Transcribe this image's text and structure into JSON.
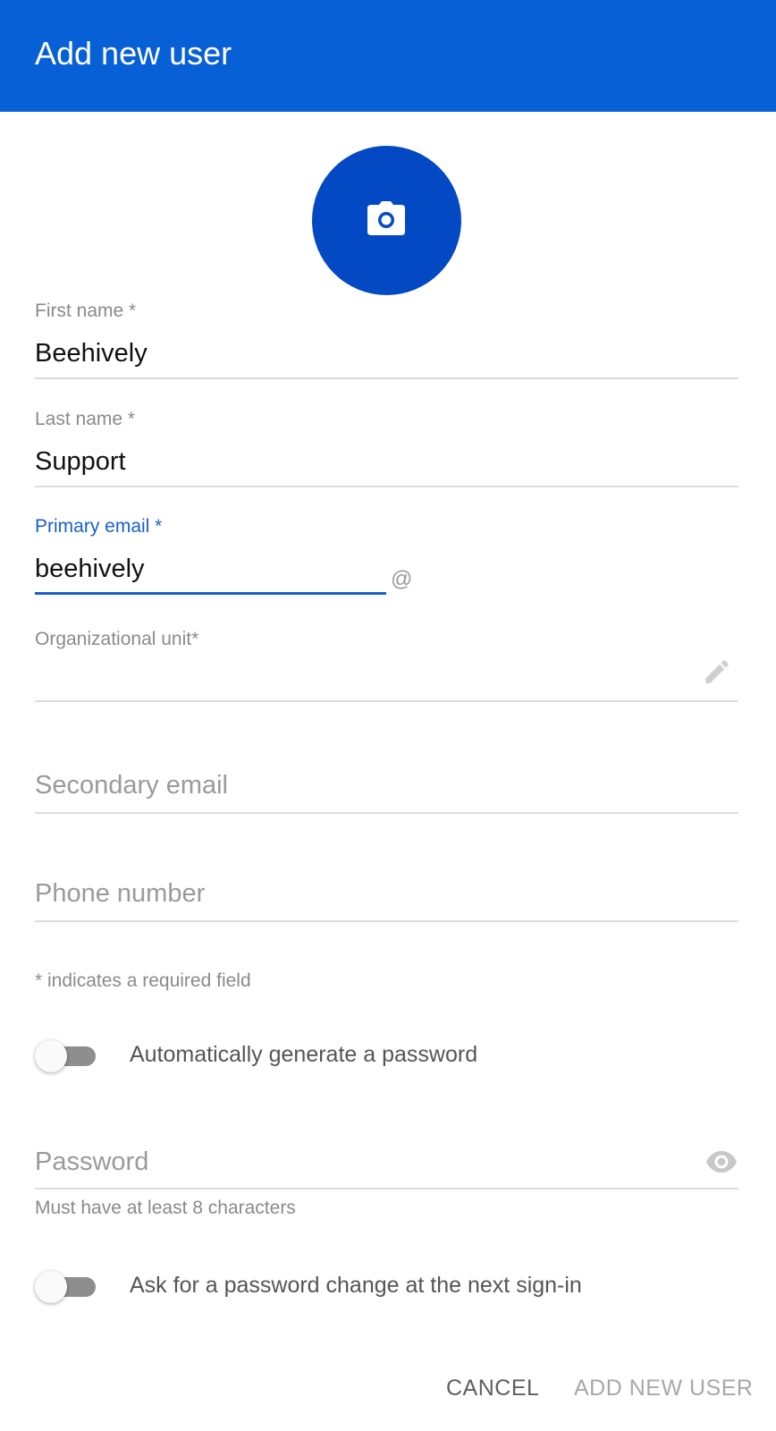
{
  "header": {
    "title": "Add new user"
  },
  "photo": {
    "icon": "camera-icon",
    "bg_color": "#0449c4"
  },
  "form": {
    "first_name": {
      "label": "First name *",
      "value": "Beehively"
    },
    "last_name": {
      "label": "Last name *",
      "value": "Support"
    },
    "primary_email": {
      "label": "Primary email *",
      "value": "beehively",
      "at_symbol": "@"
    },
    "org_unit": {
      "label": "Organizational unit*",
      "edit_icon": "pencil-icon"
    },
    "secondary_email": {
      "placeholder": "Secondary email"
    },
    "phone_number": {
      "placeholder": "Phone number"
    },
    "required_note": "* indicates a required field",
    "auto_password": {
      "label": "Automatically generate a password",
      "enabled": false
    },
    "password": {
      "placeholder": "Password",
      "helper": "Must have at least 8 characters",
      "visibility_icon": "eye-icon"
    },
    "ask_password_change": {
      "label": "Ask for a password change at the next sign-in",
      "enabled": false
    }
  },
  "actions": {
    "cancel": "CANCEL",
    "add": "ADD NEW USER"
  },
  "colors": {
    "primary": "#0760d6",
    "accent": "#1a5fcf"
  }
}
